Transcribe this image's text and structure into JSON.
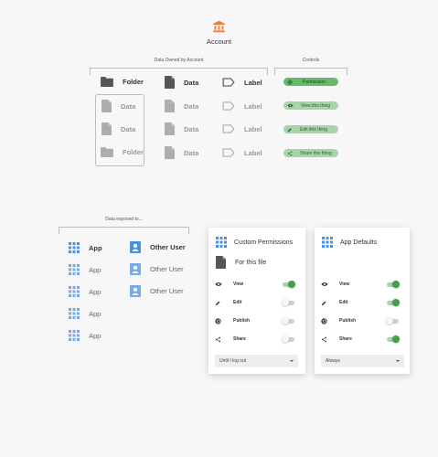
{
  "account": {
    "label": "Account",
    "icon": "bank-icon",
    "icon_color": "#e8803a"
  },
  "data_owned": {
    "heading": "Data Owned by Account",
    "header_row": [
      {
        "icon": "folder-icon",
        "label": "Folder"
      },
      {
        "icon": "file-icon",
        "label": "Data"
      },
      {
        "icon": "label-icon",
        "label": "Label"
      }
    ],
    "rows": [
      {
        "col1": "Data",
        "col2": "Data",
        "col3": "Label",
        "col1_icon": "file-icon"
      },
      {
        "col1": "Data",
        "col2": "Data",
        "col3": "Label",
        "col1_icon": "file-icon"
      },
      {
        "col1": "Folder",
        "col2": "Data",
        "col3": "Label",
        "col1_icon": "folder-icon"
      }
    ]
  },
  "controls": {
    "heading": "Controls",
    "items": [
      {
        "label": "Permission",
        "icon": "gear-icon"
      },
      {
        "label": "View this thing",
        "icon": "eye-icon"
      },
      {
        "label": "Edit this thing",
        "icon": "pencil-icon"
      },
      {
        "label": "Share this thing",
        "icon": "share-icon"
      }
    ]
  },
  "exposed": {
    "heading": "Data exposed to...",
    "apps": [
      "App",
      "App",
      "App",
      "App",
      "App"
    ],
    "users": [
      "Other User",
      "Other User",
      "Other User"
    ]
  },
  "custom_card": {
    "title": "Custom Permissions",
    "subtitle": "For this file",
    "rows": [
      {
        "label": "View",
        "icon": "eye-icon",
        "on": true
      },
      {
        "label": "Edit",
        "icon": "pencil-icon",
        "on": false
      },
      {
        "label": "Publish",
        "icon": "globe-icon",
        "on": false
      },
      {
        "label": "Share",
        "icon": "share-icon",
        "on": false
      }
    ],
    "dropdown_value": "Until I log out"
  },
  "defaults_card": {
    "title": "App Defaults",
    "rows": [
      {
        "label": "View",
        "icon": "eye-icon",
        "on": true
      },
      {
        "label": "Edit",
        "icon": "pencil-icon",
        "on": true
      },
      {
        "label": "Publish",
        "icon": "globe-icon",
        "on": false
      },
      {
        "label": "Share",
        "icon": "share-icon",
        "on": true
      }
    ],
    "dropdown_value": "Always"
  },
  "colors": {
    "green": "#66bb6a",
    "blue": "#4a90e2",
    "gray_icon": "#555555"
  }
}
